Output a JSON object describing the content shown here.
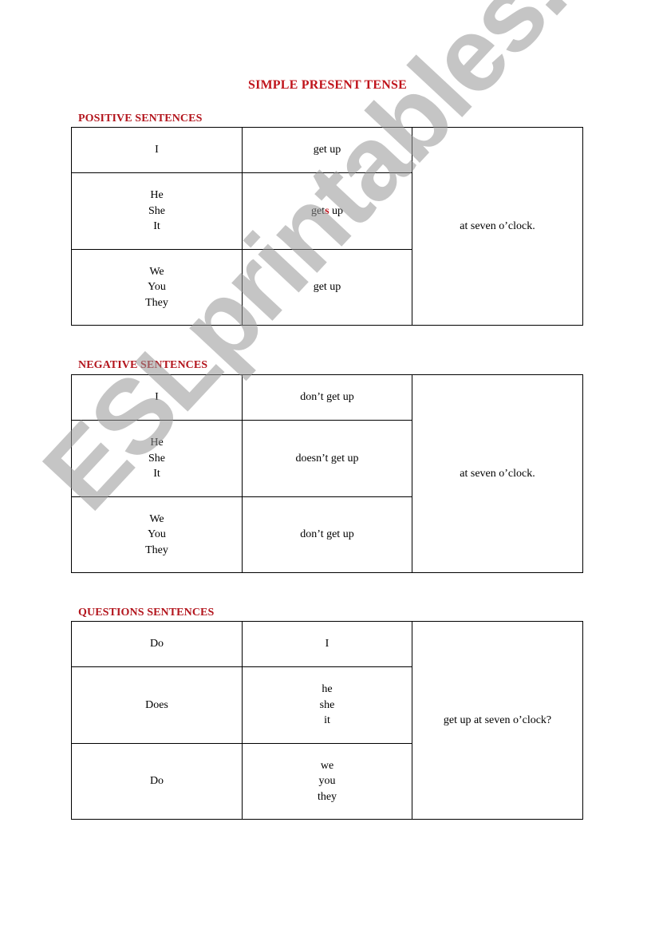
{
  "title": "SIMPLE PRESENT TENSE",
  "colors": {
    "accent_red": "#c0141c",
    "watermark_gray": "#a0a0a0"
  },
  "watermark": "ESLprintables.com",
  "positive": {
    "label": "POSITIVE SENTENCES",
    "rows": [
      {
        "subject": [
          "I"
        ],
        "verb_prefix": "get",
        "verb_highlight": "",
        "verb_suffix": " up"
      },
      {
        "subject": [
          "He",
          "She",
          "It"
        ],
        "verb_prefix": "get",
        "verb_highlight": "s",
        "verb_suffix": " up"
      },
      {
        "subject": [
          "We",
          "You",
          "They"
        ],
        "verb_prefix": "get",
        "verb_highlight": "",
        "verb_suffix": " up"
      }
    ],
    "ending": "at seven o’clock."
  },
  "negative": {
    "label": "NEGATIVE SENTENCES",
    "rows": [
      {
        "subject": [
          "I"
        ],
        "verb": "don’t get up"
      },
      {
        "subject": [
          "He",
          "She",
          "It"
        ],
        "verb": "doesn’t get up"
      },
      {
        "subject": [
          "We",
          "You",
          "They"
        ],
        "verb": "don’t get up"
      }
    ],
    "ending": "at seven o’clock."
  },
  "questions": {
    "label": "QUESTIONS SENTENCES",
    "rows": [
      {
        "auxiliary": "Do",
        "subject": [
          "I"
        ]
      },
      {
        "auxiliary": "Does",
        "subject": [
          "he",
          "she",
          "it"
        ]
      },
      {
        "auxiliary": "Do",
        "subject": [
          "we",
          "you",
          "they"
        ]
      }
    ],
    "ending": "get up at seven o’clock?"
  }
}
